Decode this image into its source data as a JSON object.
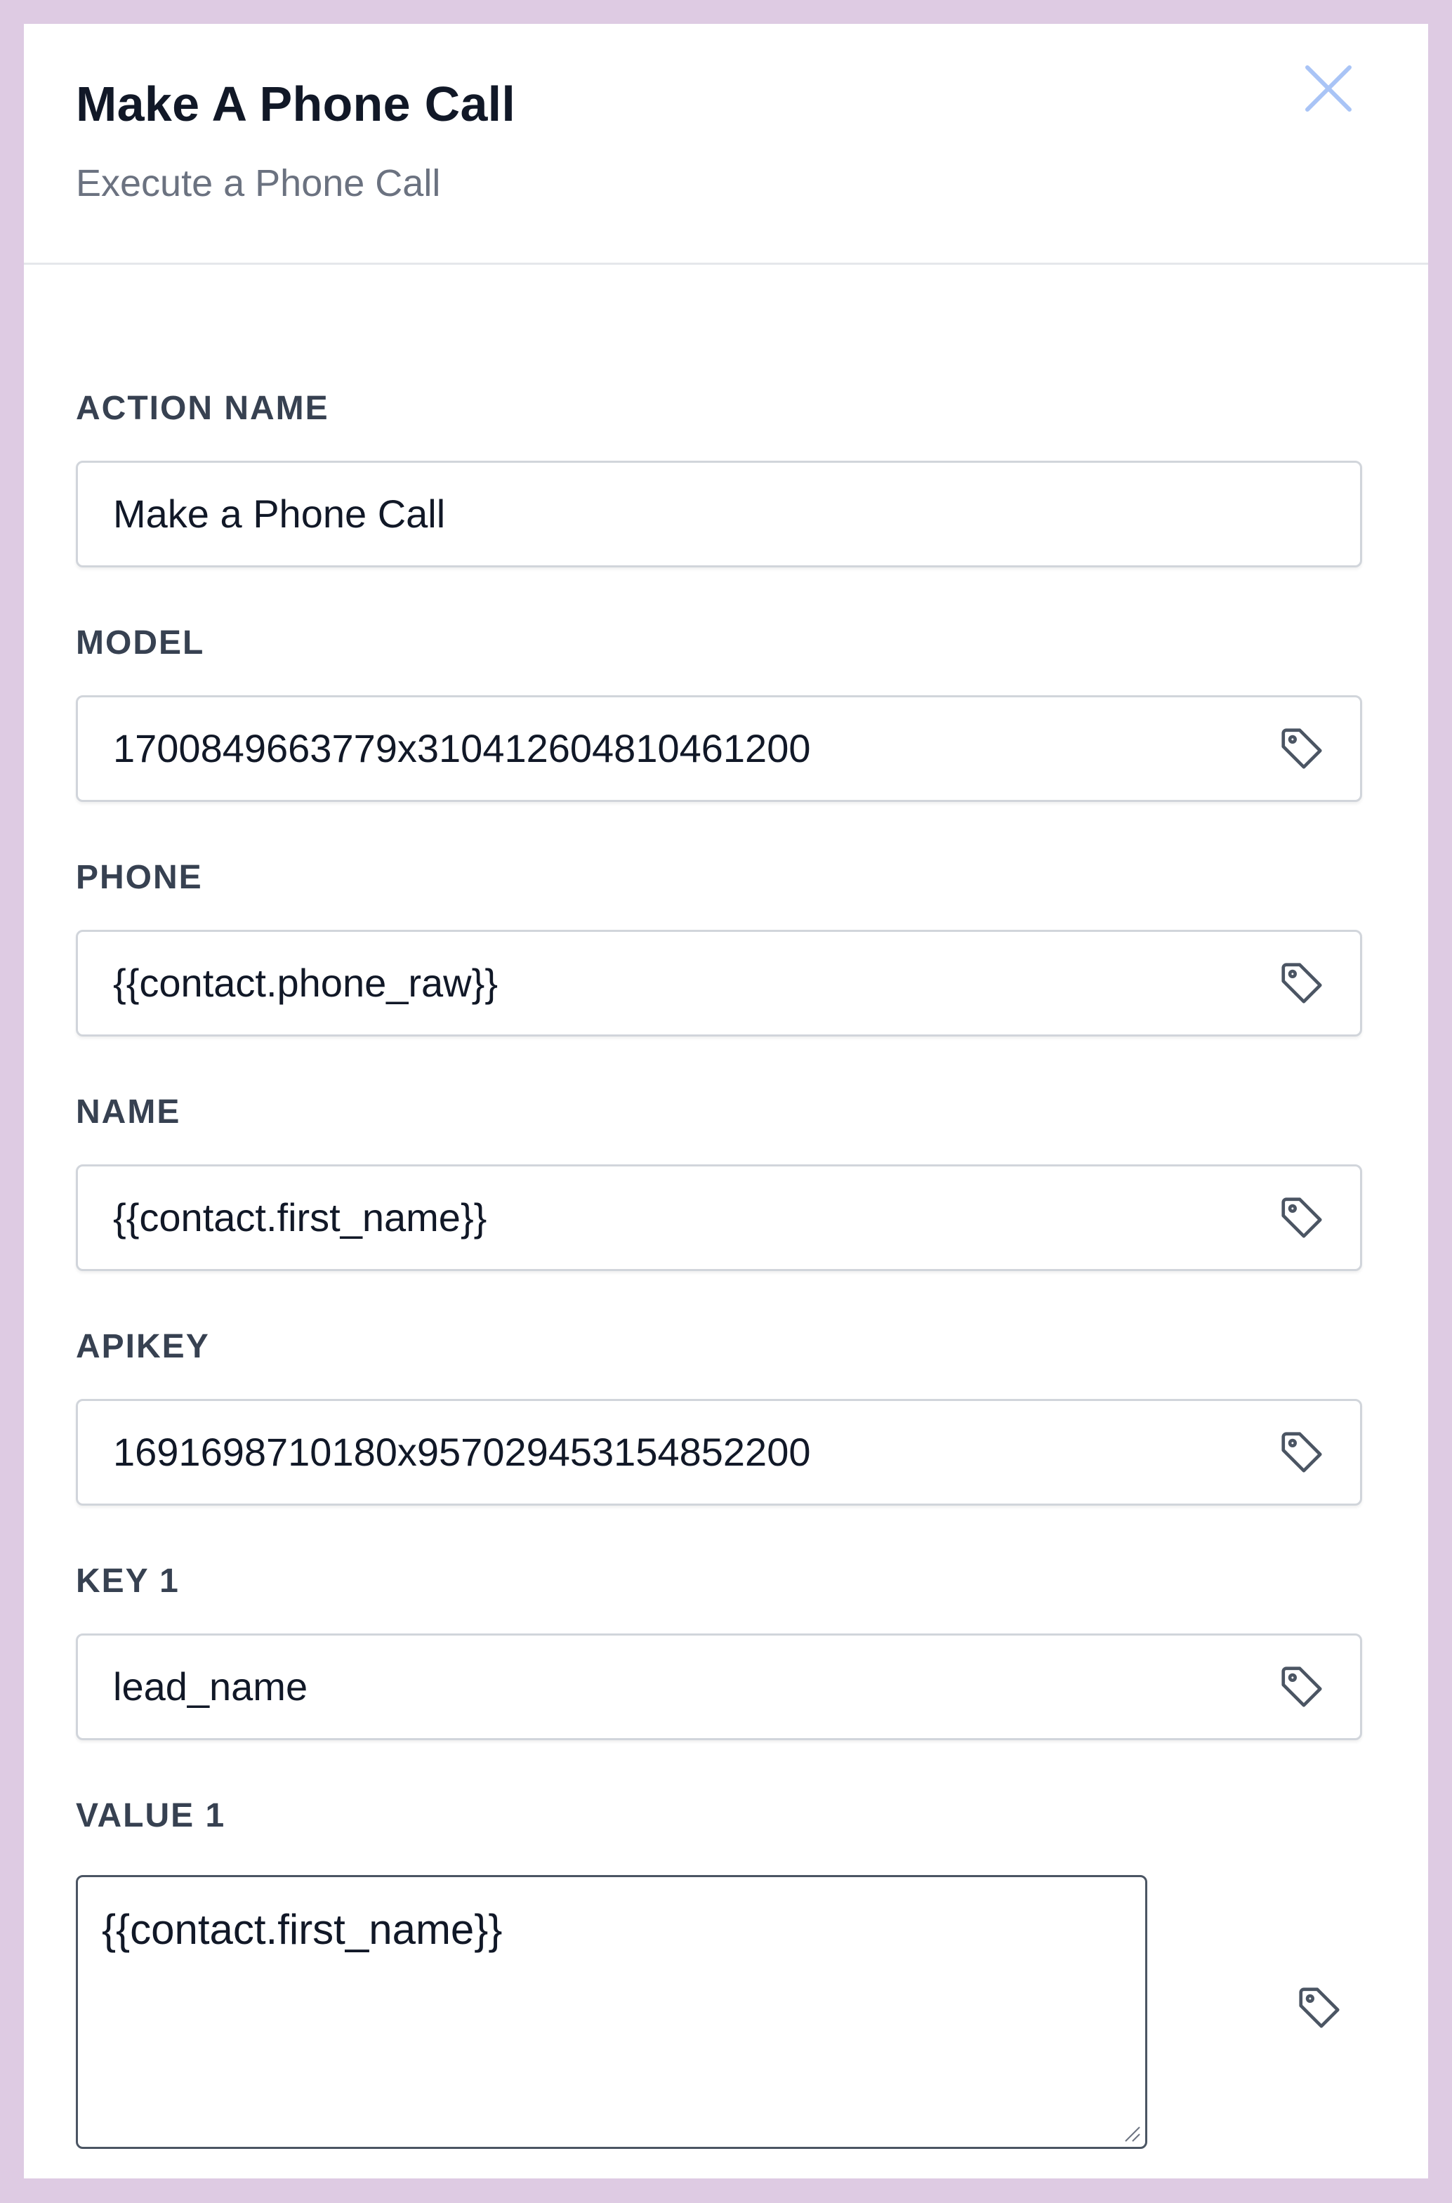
{
  "window": {
    "background_color": "#decbe3"
  },
  "header": {
    "title": "Make A Phone Call",
    "subtitle": "Execute a Phone Call",
    "close_icon": "close-icon",
    "close_color": "#a9c4f6"
  },
  "form": {
    "fields": [
      {
        "label": "ACTION NAME",
        "value": "Make a Phone Call",
        "has_tag_icon": false
      },
      {
        "label": "MODEL",
        "value": "1700849663779x310412604810461200",
        "has_tag_icon": true
      },
      {
        "label": "PHONE",
        "value": "{{contact.phone_raw}}",
        "has_tag_icon": true
      },
      {
        "label": "NAME",
        "value": "{{contact.first_name}}",
        "has_tag_icon": true
      },
      {
        "label": "APIKEY",
        "value": "1691698710180x957029453154852200",
        "has_tag_icon": true
      },
      {
        "label": "KEY 1",
        "value": "lead_name",
        "has_tag_icon": true
      },
      {
        "label": "VALUE 1",
        "value": "{{contact.first_name}}",
        "has_tag_icon": true,
        "multiline": true
      }
    ],
    "tag_icon": "tag-icon"
  }
}
